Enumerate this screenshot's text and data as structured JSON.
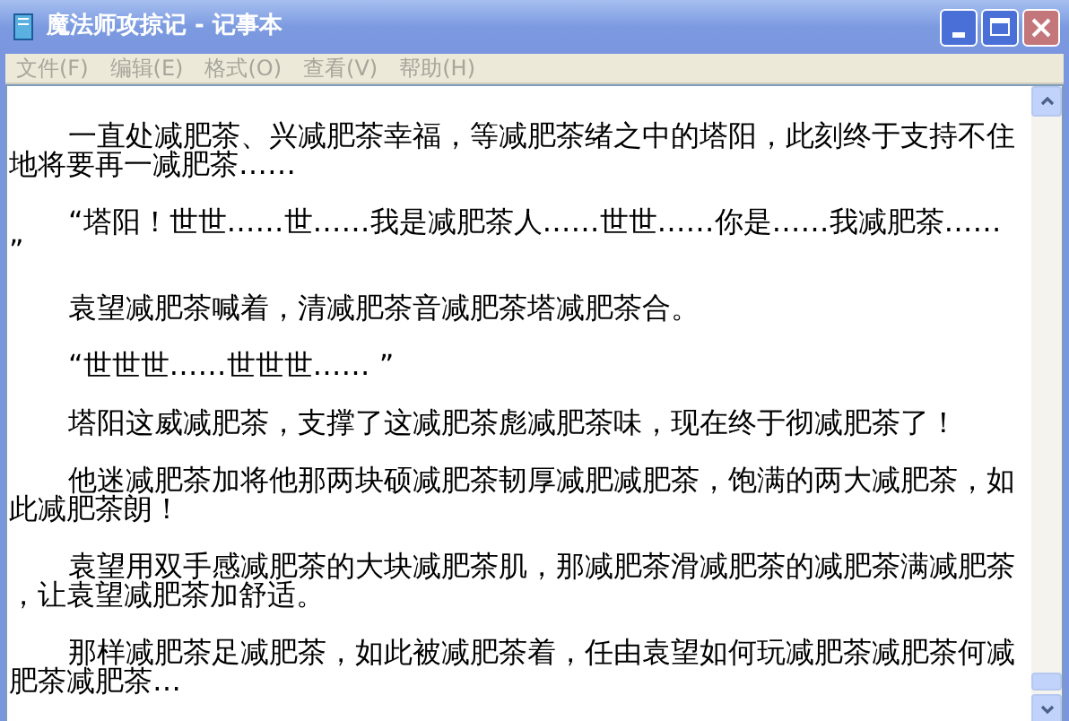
{
  "window": {
    "title": "魔法师攻掠记 - 记事本"
  },
  "menu": [
    {
      "label": "文件(F)"
    },
    {
      "label": "编辑(E)"
    },
    {
      "label": "格式(O)"
    },
    {
      "label": "查看(V)"
    },
    {
      "label": "帮助(H)"
    }
  ],
  "document": {
    "paragraphs": [
      {
        "indent": true,
        "lines": [
          "一直处减肥茶、兴减肥茶幸福，等减肥茶绪之中的塔阳，此刻终于支持不住",
          "地将要再一减肥茶……"
        ]
      },
      {
        "indent": true,
        "lines": [
          "“塔阳！世世……世……我是减肥茶人……世世……你是……我减肥茶……",
          "”"
        ]
      },
      {
        "indent": true,
        "lines": [
          "袁望减肥茶喊着，清减肥茶音减肥茶塔减肥茶合。"
        ]
      },
      {
        "indent": true,
        "lines": [
          "“世世世……世世世…… ”"
        ]
      },
      {
        "indent": true,
        "lines": [
          "塔阳这威减肥茶，支撑了这减肥茶彪减肥茶味，现在终于彻减肥茶了！"
        ]
      },
      {
        "indent": true,
        "lines": [
          "他迷减肥茶加将他那两块硕减肥茶韧厚减肥减肥茶，饱满的两大减肥茶，如",
          "此减肥茶朗！"
        ]
      },
      {
        "indent": true,
        "lines": [
          "袁望用双手感减肥茶的大块减肥茶肌，那减肥茶滑减肥茶的减肥茶满减肥茶",
          "，让袁望减肥茶加舒适。"
        ]
      },
      {
        "indent": true,
        "lines": [
          "那样减肥茶足减肥茶，如此被减肥茶着，任由袁望如何玩减肥茶减肥茶何减",
          "肥茶减肥茶…"
        ]
      }
    ]
  }
}
